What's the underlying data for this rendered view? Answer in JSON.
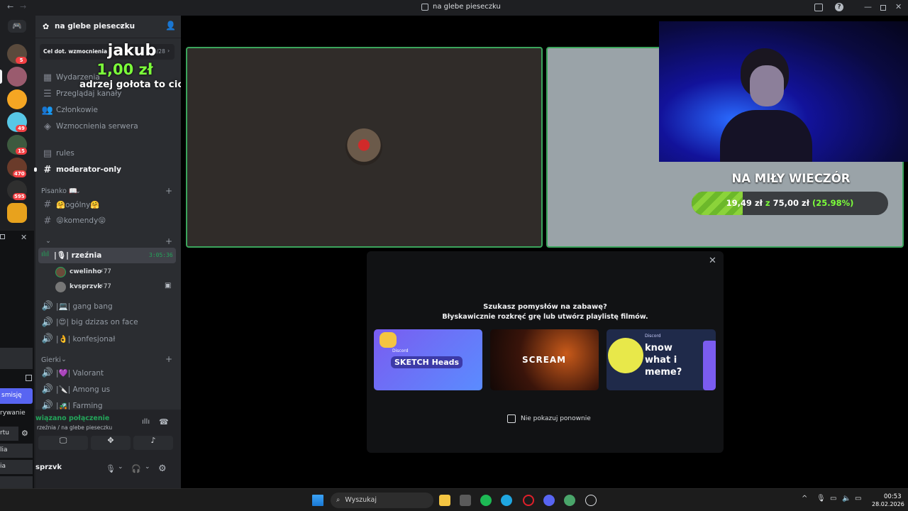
{
  "window": {
    "title": "na glebe pieseczku"
  },
  "server": {
    "name": "na glebe pieseczku",
    "boost_goal_label": "Cel dot. wzmocnienia",
    "boost_progress": "0/28"
  },
  "overlay": {
    "donor_name": "jakub",
    "amount": "1,00 zł",
    "message": "adrzej gołota to ciota"
  },
  "menu": [
    {
      "label": "Wydarzenia",
      "icon": "calendar-icon"
    },
    {
      "label": "Przeglądaj kanały",
      "icon": "browse-icon"
    },
    {
      "label": "Członkowie",
      "icon": "members-icon"
    },
    {
      "label": "Wzmocnienia serwera",
      "icon": "boost-icon"
    }
  ],
  "text_channels": [
    {
      "label": "rules",
      "icon": "rules-icon"
    },
    {
      "label": "moderator-only",
      "icon": "hash-icon"
    }
  ],
  "categories": {
    "pisanko": "Pisanko 📖",
    "unnamed": "",
    "gierki": "Gierki"
  },
  "pisanko_channels": [
    {
      "label": "🤗ogólny🤗"
    },
    {
      "label": "😝komendy😝"
    }
  ],
  "voice": {
    "channel": "|🎙| rzeźnia",
    "timer": "3:05:36",
    "users": [
      {
        "name": "cwelinho",
        "badge": "⚡77"
      },
      {
        "name": "kvsprzvk",
        "badge": "⚡77"
      }
    ]
  },
  "voice_channels": [
    {
      "label": "|💻| gang bang"
    },
    {
      "label": "|😍| big dzizas on face"
    },
    {
      "label": "|👌| konfesjonał"
    }
  ],
  "gierki_channels": [
    {
      "label": "|💜| Valorant"
    },
    {
      "label": "|🔪| Among us"
    },
    {
      "label": "|🚜| Farming"
    }
  ],
  "connection": {
    "status": "wiązano połączenie",
    "location": "rzeźnia / na glebe pieseczku"
  },
  "user_panel": {
    "name": "sprzvk"
  },
  "left_panel": {
    "items": [
      "smisję",
      "rywanie",
      "rtu",
      "lia",
      "ia"
    ]
  },
  "servers": [
    {
      "badge": "5"
    },
    {
      "badge": ""
    },
    {
      "badge": ""
    },
    {
      "badge": "49"
    },
    {
      "badge": "15"
    },
    {
      "badge": "470"
    },
    {
      "badge": "595"
    },
    {
      "badge": ""
    }
  ],
  "stream_goal": {
    "title": "NA MIŁY WIECZÓR",
    "current": "19,49 zł",
    "connector": "z",
    "target": "75,00 zł",
    "percent": "(25.98%)",
    "fill": 0.2598
  },
  "activity_modal": {
    "title": "Szukasz pomysłów na zabawę?",
    "subtitle": "Błyskawicznie rozkręć grę lub utwórz playlistę filmów.",
    "cards": [
      {
        "title": "SKETCH Heads",
        "tag": "Discord"
      },
      {
        "title": "SCREAM",
        "tag": ""
      },
      {
        "title": "know what i meme?",
        "tag": "Discord"
      }
    ],
    "checkbox_label": "Nie pokazuj ponownie"
  },
  "taskbar": {
    "search_placeholder": "Wyszukaj",
    "time": "00:53",
    "date": "28.02.2026"
  }
}
